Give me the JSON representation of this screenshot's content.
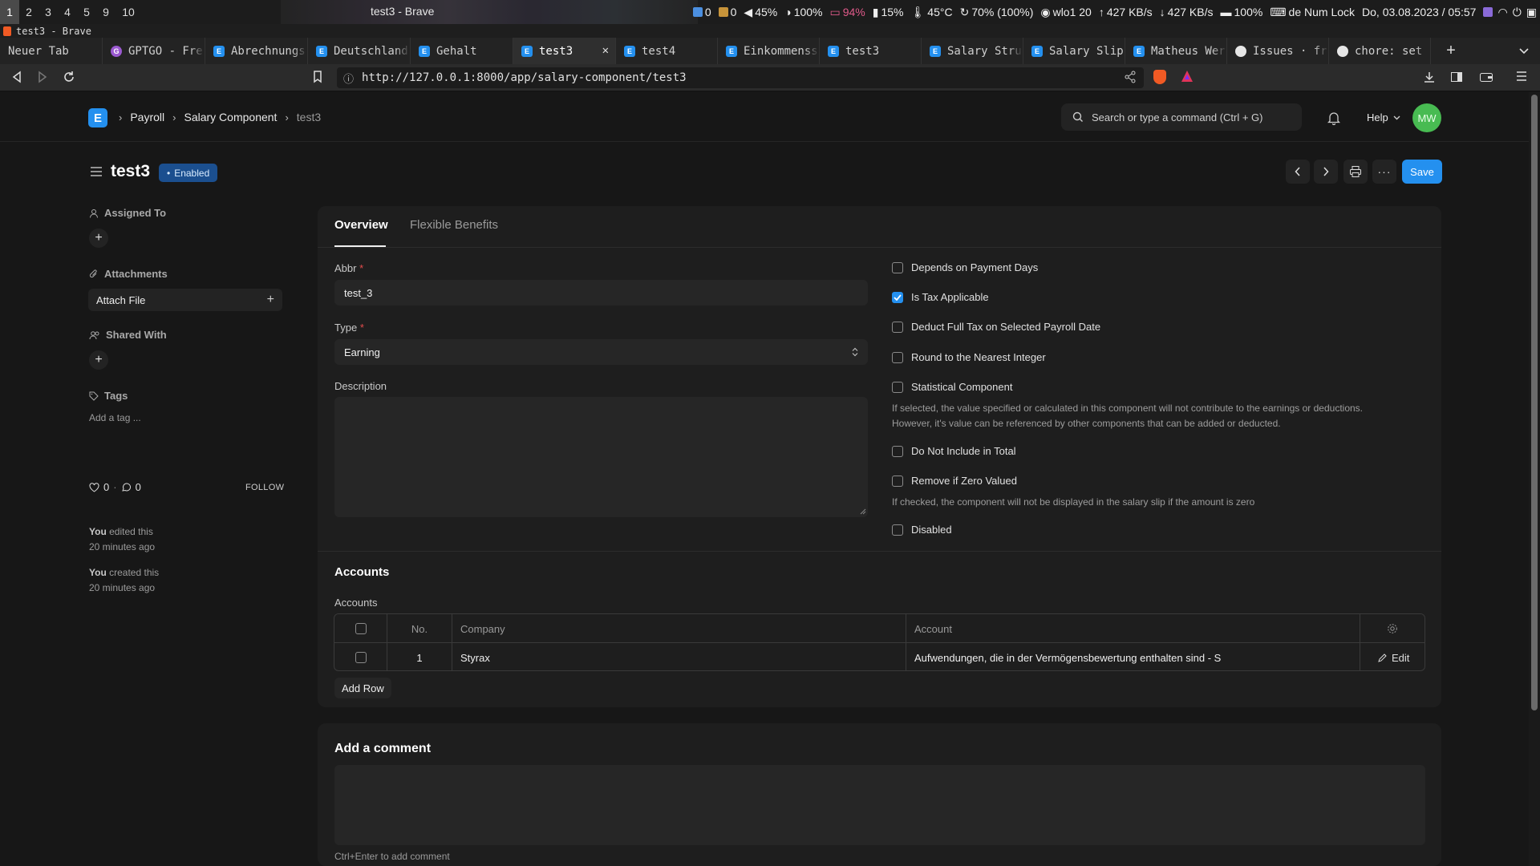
{
  "system_bar": {
    "workspaces": [
      "1",
      "2",
      "3",
      "4",
      "5",
      "9",
      "10"
    ],
    "window_title": "test3 - Brave",
    "status_items": [
      "0",
      "0",
      "45%",
      "100%",
      "94%",
      "15%",
      "45°C",
      "70% (100%)",
      "wlo1 20",
      "427 KB/s",
      "427 KB/s",
      "100%",
      "de Num Lock",
      "Do, 03.08.2023 / 05:57"
    ]
  },
  "title_strip": {
    "text": "test3 - Brave"
  },
  "tabs": [
    {
      "label": "Neuer Tab",
      "icon": "none"
    },
    {
      "label": "GPTGO - Fre",
      "icon": "gptgo"
    },
    {
      "label": "Abrechnungs",
      "icon": "erpnext"
    },
    {
      "label": "Deutschland",
      "icon": "erpnext"
    },
    {
      "label": "Gehalt",
      "icon": "erpnext"
    },
    {
      "label": "test3",
      "icon": "erpnext",
      "active": true
    },
    {
      "label": "test4",
      "icon": "erpnext"
    },
    {
      "label": "Einkommenss",
      "icon": "erpnext"
    },
    {
      "label": "test3",
      "icon": "erpnext"
    },
    {
      "label": "Salary Stru",
      "icon": "erpnext"
    },
    {
      "label": "Salary Slip",
      "icon": "erpnext"
    },
    {
      "label": "Matheus Wer",
      "icon": "erpnext"
    },
    {
      "label": "Issues · fr",
      "icon": "github"
    },
    {
      "label": "chore: set",
      "icon": "github"
    }
  ],
  "address_bar": {
    "url": "http://127.0.0.1:8000/app/salary-component/test3"
  },
  "app_nav": {
    "logo": "E",
    "breadcrumbs": [
      "Payroll",
      "Salary Component",
      "test3"
    ],
    "search_placeholder": "Search or type a command (Ctrl + G)",
    "help_label": "Help",
    "avatar_initials": "MW"
  },
  "page_head": {
    "title": "test3",
    "status_badge": "Enabled",
    "save_label": "Save"
  },
  "sidebar": {
    "assigned_to": "Assigned To",
    "attachments": "Attachments",
    "attach_file": "Attach File",
    "shared_with": "Shared With",
    "tags": "Tags",
    "add_tag": "Add a tag ...",
    "likes": "0",
    "comments": "0",
    "follow": "FOLLOW",
    "activity": [
      {
        "who": "You",
        "what": "edited this",
        "when": "20 minutes ago"
      },
      {
        "who": "You",
        "what": "created this",
        "when": "20 minutes ago"
      }
    ]
  },
  "form": {
    "tabs": [
      "Overview",
      "Flexible Benefits"
    ],
    "abbr_label": "Abbr",
    "abbr_value": "test_3",
    "type_label": "Type",
    "type_value": "Earning",
    "description_label": "Description",
    "checkboxes": [
      {
        "label": "Depends on Payment Days",
        "checked": false
      },
      {
        "label": "Is Tax Applicable",
        "checked": true
      },
      {
        "label": "Deduct Full Tax on Selected Payroll Date",
        "checked": false
      },
      {
        "label": "Round to the Nearest Integer",
        "checked": false
      },
      {
        "label": "Statistical Component",
        "checked": false
      },
      {
        "label": "Do Not Include in Total",
        "checked": false
      },
      {
        "label": "Remove if Zero Valued",
        "checked": false
      },
      {
        "label": "Disabled",
        "checked": false
      }
    ],
    "statistical_help": "If selected, the value specified or calculated in this component will not contribute to the earnings or deductions. However, it's value can be referenced by other components that can be added or deducted.",
    "zero_help": "If checked, the component will not be displayed in the salary slip if the amount is zero"
  },
  "accounts": {
    "section_title": "Accounts",
    "table_label": "Accounts",
    "columns": [
      "No.",
      "Company",
      "Account"
    ],
    "rows": [
      {
        "no": "1",
        "company": "Styrax",
        "account": "Aufwendungen, die in der Vermögensbewertung enthalten sind - S",
        "edit": "Edit"
      }
    ],
    "add_row": "Add Row"
  },
  "comments": {
    "title": "Add a comment",
    "hint": "Ctrl+Enter to add comment"
  },
  "colors": {
    "accent": "#2490ef",
    "background": "#171717",
    "card": "#1e1e1e",
    "avatar": "#48bb52"
  }
}
